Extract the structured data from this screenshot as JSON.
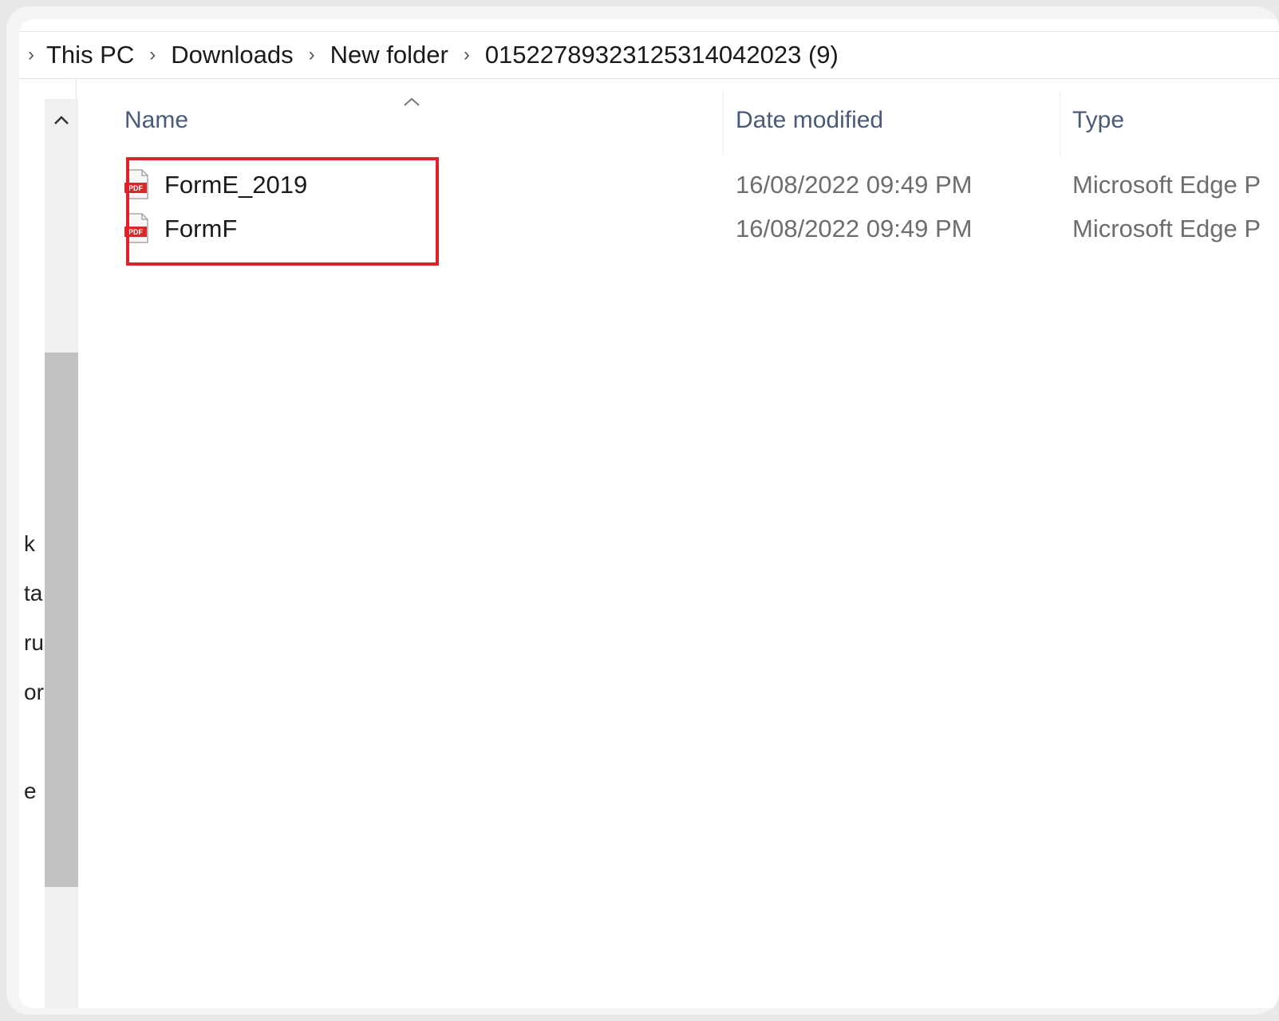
{
  "breadcrumb": [
    "This PC",
    "Downloads",
    "New folder",
    "01522789323125314042023 (9)"
  ],
  "columns": {
    "name": "Name",
    "date_modified": "Date modified",
    "type": "Type"
  },
  "files": [
    {
      "name": "FormE_2019",
      "date": "16/08/2022 09:49 PM",
      "type": "Microsoft Edge P"
    },
    {
      "name": "FormF",
      "date": "16/08/2022 09:49 PM",
      "type": "Microsoft Edge P"
    }
  ],
  "nav_fragments": [
    "k",
    "ta",
    "ru",
    "or",
    "e"
  ],
  "colors": {
    "highlight": "#e2202c",
    "header_text": "#4a5a78"
  }
}
